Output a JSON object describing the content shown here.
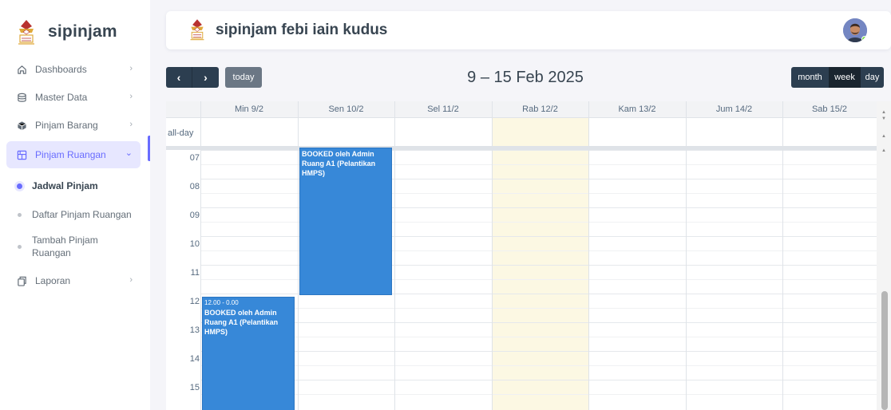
{
  "sidebar": {
    "brand": "sipinjam",
    "items": [
      {
        "label": "Dashboards",
        "icon": "home-icon",
        "chevron": "›"
      },
      {
        "label": "Master Data",
        "icon": "database-icon",
        "chevron": "›"
      },
      {
        "label": "Pinjam Barang",
        "icon": "box-icon",
        "chevron": "›"
      },
      {
        "label": "Pinjam Ruangan",
        "icon": "building-icon",
        "chevron": "⌄"
      },
      {
        "label": "Laporan",
        "icon": "document-icon",
        "chevron": "›"
      }
    ],
    "sub_items": [
      {
        "label": "Jadwal Pinjam"
      },
      {
        "label": "Daftar Pinjam Ruangan"
      },
      {
        "label": "Tambah Pinjam Ruangan"
      }
    ]
  },
  "header": {
    "title": "sipinjam febi iain kudus"
  },
  "toolbar": {
    "prev": "‹",
    "next": "›",
    "today": "today",
    "range": "9 – 15 Feb 2025",
    "views": {
      "month": "month",
      "week": "week",
      "day": "day"
    }
  },
  "calendar": {
    "days": [
      "Min 9/2",
      "Sen 10/2",
      "Sel 11/2",
      "Rab 12/2",
      "Kam 13/2",
      "Jum 14/2",
      "Sab 15/2"
    ],
    "all_day_label": "all-day",
    "hours": [
      "07",
      "08",
      "09",
      "10",
      "11",
      "12",
      "13",
      "14",
      "15"
    ],
    "events": [
      {
        "time": "",
        "title": "BOOKED oleh Admin Ruang A1 (Pelantikan HMPS)"
      },
      {
        "time": "12.00 - 0.00",
        "title": "BOOKED oleh Admin Ruang A1 (Pelantikan HMPS)"
      }
    ],
    "today_color": "#fcf8e3",
    "event_color": "#3788d8"
  },
  "colors": {
    "accent": "#696cff",
    "toolbar": "#2c3e50"
  }
}
